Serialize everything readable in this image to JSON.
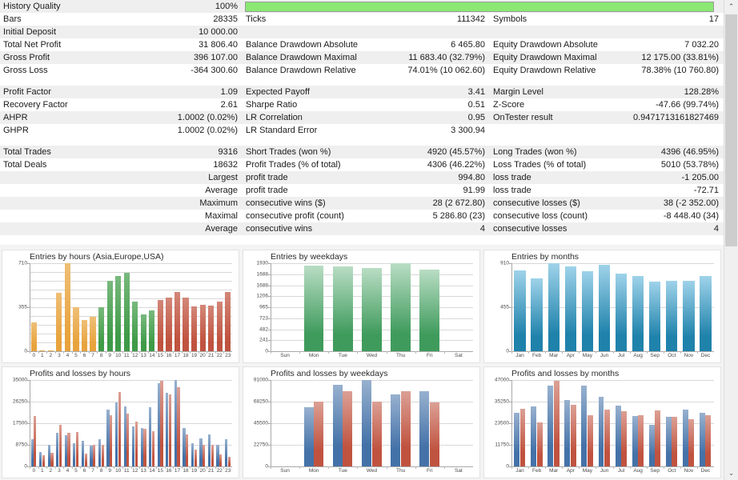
{
  "progress": {
    "name": "history-quality-bar",
    "percent": 100,
    "color": "#8ae873"
  },
  "stats": {
    "groups": [
      {
        "rows": [
          {
            "left": {
              "label": "History Quality",
              "value": "100%"
            },
            "mid": {
              "label": "",
              "value": ""
            },
            "right": {
              "label": "",
              "value": ""
            }
          },
          {
            "left": {
              "label": "Bars",
              "value": "28335"
            },
            "mid": {
              "label": "Ticks",
              "value": "111342"
            },
            "right": {
              "label": "Symbols",
              "value": "17"
            }
          },
          {
            "left": {
              "label": "Initial Deposit",
              "value": "10 000.00"
            },
            "mid": {
              "label": "",
              "value": ""
            },
            "right": {
              "label": "",
              "value": ""
            }
          },
          {
            "left": {
              "label": "Total Net Profit",
              "value": "31 806.40"
            },
            "mid": {
              "label": "Balance Drawdown Absolute",
              "value": "6 465.80"
            },
            "right": {
              "label": "Equity Drawdown Absolute",
              "value": "7 032.20"
            }
          },
          {
            "left": {
              "label": "Gross Profit",
              "value": "396 107.00"
            },
            "mid": {
              "label": "Balance Drawdown Maximal",
              "value": "11 683.40 (32.79%)"
            },
            "right": {
              "label": "Equity Drawdown Maximal",
              "value": "12 175.00 (33.81%)"
            }
          },
          {
            "left": {
              "label": "Gross Loss",
              "value": "-364 300.60"
            },
            "mid": {
              "label": "Balance Drawdown Relative",
              "value": "74.01% (10 062.60)"
            },
            "right": {
              "label": "Equity Drawdown Relative",
              "value": "78.38% (10 760.80)"
            }
          }
        ]
      },
      {
        "rows": [
          {
            "left": {
              "label": "Profit Factor",
              "value": "1.09"
            },
            "mid": {
              "label": "Expected Payoff",
              "value": "3.41"
            },
            "right": {
              "label": "Margin Level",
              "value": "128.28%"
            }
          },
          {
            "left": {
              "label": "Recovery Factor",
              "value": "2.61"
            },
            "mid": {
              "label": "Sharpe Ratio",
              "value": "0.51"
            },
            "right": {
              "label": "Z-Score",
              "value": "-47.66 (99.74%)"
            }
          },
          {
            "left": {
              "label": "AHPR",
              "value": "1.0002 (0.02%)"
            },
            "mid": {
              "label": "LR Correlation",
              "value": "0.95"
            },
            "right": {
              "label": "OnTester result",
              "value": "0.9471713161827469"
            }
          },
          {
            "left": {
              "label": "GHPR",
              "value": "1.0002 (0.02%)"
            },
            "mid": {
              "label": "LR Standard Error",
              "value": "3 300.94"
            },
            "right": {
              "label": "",
              "value": ""
            }
          }
        ]
      },
      {
        "rows": [
          {
            "left": {
              "label": "Total Trades",
              "value": "9316"
            },
            "mid": {
              "label": "Short Trades (won %)",
              "value": "4920 (45.57%)"
            },
            "right": {
              "label": "Long Trades (won %)",
              "value": "4396 (46.95%)"
            }
          },
          {
            "left": {
              "label": "Total Deals",
              "value": "18632"
            },
            "mid": {
              "label": "Profit Trades (% of total)",
              "value": "4306 (46.22%)"
            },
            "right": {
              "label": "Loss Trades (% of total)",
              "value": "5010 (53.78%)"
            }
          },
          {
            "left": {
              "label": "",
              "value": "Largest"
            },
            "mid": {
              "label": "profit trade",
              "value": "994.80"
            },
            "right": {
              "label": "loss trade",
              "value": "-1 205.00"
            }
          },
          {
            "left": {
              "label": "",
              "value": "Average"
            },
            "mid": {
              "label": "profit trade",
              "value": "91.99"
            },
            "right": {
              "label": "loss trade",
              "value": "-72.71"
            }
          },
          {
            "left": {
              "label": "",
              "value": "Maximum"
            },
            "mid": {
              "label": "consecutive wins ($)",
              "value": "28 (2 672.80)"
            },
            "right": {
              "label": "consecutive losses ($)",
              "value": "38 (-2 352.00)"
            }
          },
          {
            "left": {
              "label": "",
              "value": "Maximal"
            },
            "mid": {
              "label": "consecutive profit (count)",
              "value": "5 286.80 (23)"
            },
            "right": {
              "label": "consecutive loss (count)",
              "value": "-8 448.40 (34)"
            }
          },
          {
            "left": {
              "label": "",
              "value": "Average"
            },
            "mid": {
              "label": "consecutive wins",
              "value": "4"
            },
            "right": {
              "label": "consecutive losses",
              "value": "4"
            }
          }
        ]
      }
    ]
  },
  "chart_data": [
    {
      "id": "entries-by-hours",
      "type": "bar",
      "title": "Entries by hours (Asia,Europe,USA)",
      "xlabel": "",
      "ylabel": "",
      "ylim": [
        0,
        710
      ],
      "yticks": [
        0,
        355,
        710
      ],
      "ytick_labels": [
        "0",
        "355",
        "710"
      ],
      "gridlines": [
        71,
        142,
        213,
        284,
        355,
        426,
        497,
        568,
        639,
        710
      ],
      "categories": [
        "0",
        "1",
        "2",
        "3",
        "4",
        "5",
        "6",
        "7",
        "8",
        "9",
        "10",
        "11",
        "12",
        "13",
        "14",
        "15",
        "16",
        "17",
        "18",
        "19",
        "20",
        "21",
        "22",
        "23"
      ],
      "values": [
        230,
        8,
        4,
        470,
        710,
        358,
        255,
        278,
        355,
        565,
        610,
        630,
        400,
        300,
        330,
        410,
        430,
        480,
        430,
        360,
        375,
        365,
        400,
        480
      ],
      "session_colors": {
        "asia": "#e8a33d",
        "europe": "#3f9b47",
        "usa": "#c0533f"
      },
      "bar_sessions": [
        "asia",
        "asia",
        "asia",
        "asia",
        "asia",
        "asia",
        "asia",
        "asia",
        "europe",
        "europe",
        "europe",
        "europe",
        "europe",
        "europe",
        "europe",
        "usa",
        "usa",
        "usa",
        "usa",
        "usa",
        "usa",
        "usa",
        "usa",
        "usa"
      ]
    },
    {
      "id": "entries-by-weekdays",
      "type": "bar",
      "title": "Entries by weekdays",
      "xlabel": "",
      "ylabel": "",
      "ylim": [
        0,
        1930
      ],
      "yticks": [
        0,
        241,
        482,
        723,
        965,
        1206,
        1447,
        1688,
        1930
      ],
      "ytick_labels": [
        "0",
        "241",
        "482",
        "723",
        "965",
        "1206",
        "1688",
        "1688",
        "1930"
      ],
      "categories": [
        "Sun",
        "Mon",
        "Tue",
        "Wed",
        "Thu",
        "Fri",
        "Sat"
      ],
      "values": [
        0,
        1880,
        1855,
        1820,
        1930,
        1790,
        0
      ],
      "bar_color_top": "#b9ddc4",
      "bar_color_bottom": "#3f9b5c"
    },
    {
      "id": "entries-by-months",
      "type": "bar",
      "title": "Entries by months",
      "xlabel": "",
      "ylabel": "",
      "ylim": [
        0,
        910
      ],
      "yticks": [
        0,
        455,
        910
      ],
      "ytick_labels": [
        "0",
        "455",
        "910"
      ],
      "categories": [
        "Jan",
        "Feb",
        "Mar",
        "Apr",
        "May",
        "Jun",
        "Jul",
        "Aug",
        "Sep",
        "Oct",
        "Nov",
        "Dec"
      ],
      "values": [
        838,
        755,
        910,
        880,
        825,
        890,
        805,
        775,
        720,
        725,
        730,
        780
      ],
      "bar_color_top": "#9fd3ea",
      "bar_color_bottom": "#1f82ab"
    },
    {
      "id": "profits-losses-by-hours",
      "type": "bar",
      "title": "Profits and losses by hours",
      "xlabel": "",
      "ylabel": "",
      "ylim": [
        0,
        35000
      ],
      "yticks": [
        0,
        8750,
        17500,
        26250,
        35000
      ],
      "ytick_labels": [
        "0",
        "8750",
        "17500",
        "26250",
        "35000"
      ],
      "categories": [
        "0",
        "1",
        "2",
        "3",
        "4",
        "5",
        "6",
        "7",
        "8",
        "9",
        "10",
        "11",
        "12",
        "13",
        "14",
        "15",
        "16",
        "17",
        "18",
        "19",
        "20",
        "21",
        "22",
        "23"
      ],
      "series": [
        {
          "name": "profit",
          "color": "#4472a8",
          "values": [
            10900,
            5800,
            8900,
            13600,
            12500,
            9400,
            10300,
            8300,
            11000,
            23000,
            26000,
            24400,
            16200,
            15600,
            24100,
            33600,
            29700,
            35000,
            15600,
            9500,
            11200,
            12900,
            8800,
            11100
          ]
        },
        {
          "name": "loss",
          "color": "#c0533f",
          "values": [
            20500,
            4400,
            5600,
            16800,
            13700,
            14100,
            5200,
            8800,
            8700,
            20600,
            30000,
            21400,
            18000,
            15200,
            14400,
            34600,
            29300,
            32000,
            13000,
            6800,
            8700,
            8800,
            5000,
            3800
          ]
        }
      ]
    },
    {
      "id": "profits-losses-by-weekdays",
      "type": "bar",
      "title": "Profits and losses by weekdays",
      "xlabel": "",
      "ylabel": "",
      "ylim": [
        0,
        91000
      ],
      "yticks": [
        0,
        22750,
        45500,
        68250,
        91000
      ],
      "ytick_labels": [
        "0",
        "22750",
        "45500",
        "68250",
        "91000"
      ],
      "categories": [
        "Sun",
        "Mon",
        "Tue",
        "Wed",
        "Thu",
        "Fri",
        "Sat"
      ],
      "series": [
        {
          "name": "profit",
          "color": "#4472a8",
          "values": [
            0,
            62000,
            86000,
            91000,
            75500,
            79000,
            0
          ]
        },
        {
          "name": "loss",
          "color": "#c0533f",
          "values": [
            0,
            68500,
            79000,
            68500,
            79000,
            67500,
            0
          ]
        }
      ]
    },
    {
      "id": "profits-losses-by-months",
      "type": "bar",
      "title": "Profits and losses by months",
      "xlabel": "",
      "ylabel": "",
      "ylim": [
        0,
        47000
      ],
      "yticks": [
        0,
        11750,
        23500,
        35250,
        47000
      ],
      "ytick_labels": [
        "0",
        "11750",
        "23500",
        "35250",
        "47000"
      ],
      "categories": [
        "Jan",
        "Feb",
        "Mar",
        "Apr",
        "May",
        "Jun",
        "Jul",
        "Aug",
        "Sep",
        "Oct",
        "Nov",
        "Dec"
      ],
      "series": [
        {
          "name": "profit",
          "color": "#4472a8",
          "values": [
            29000,
            32500,
            44000,
            36000,
            44000,
            38000,
            33000,
            27500,
            22500,
            27000,
            31000,
            29000
          ]
        },
        {
          "name": "loss",
          "color": "#c0533f",
          "values": [
            31500,
            24000,
            46500,
            33500,
            28000,
            31000,
            30000,
            28000,
            30500,
            27000,
            25500,
            28000
          ]
        }
      ]
    }
  ],
  "scrollbar": {
    "up_glyph": "⌃",
    "down_glyph": "⌄"
  }
}
